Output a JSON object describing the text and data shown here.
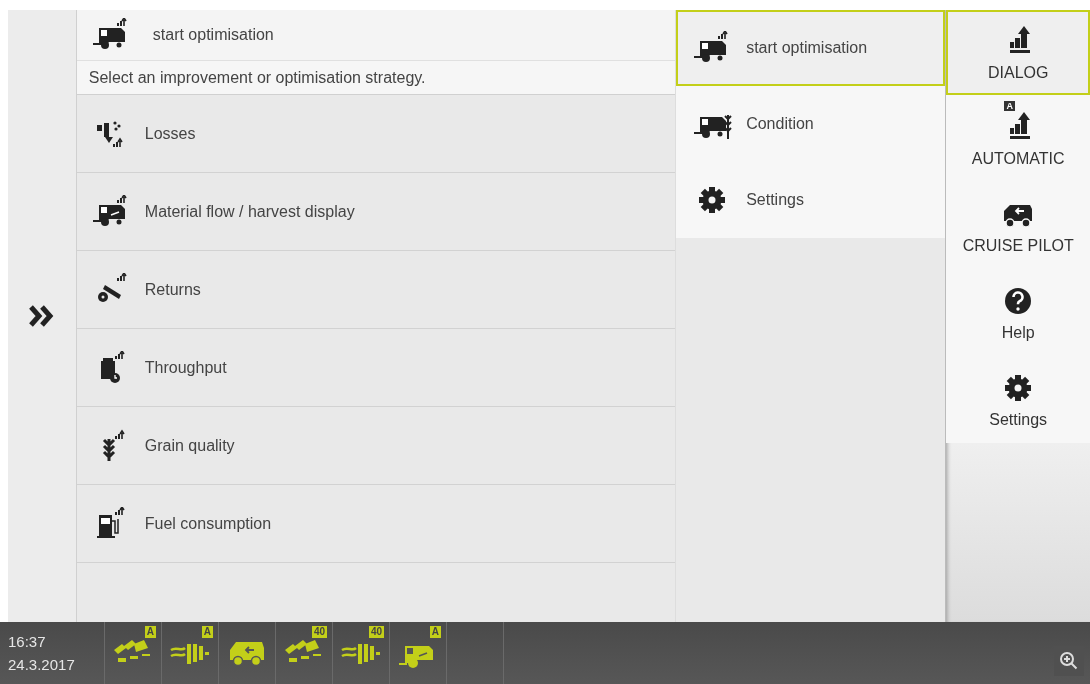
{
  "strategy": {
    "title": "start optimisation",
    "prompt": "Select an improvement or optimisation strategy.",
    "options": [
      {
        "kind": "losses",
        "label": "Losses"
      },
      {
        "kind": "material",
        "label": "Material flow / harvest display"
      },
      {
        "kind": "returns",
        "label": "Returns"
      },
      {
        "kind": "throughput",
        "label": "Throughput"
      },
      {
        "kind": "grain",
        "label": "Grain quality"
      },
      {
        "kind": "fuel",
        "label": "Fuel consumption"
      }
    ]
  },
  "menu": [
    {
      "kind": "combine",
      "label": "start optimisation",
      "selected": true
    },
    {
      "kind": "condition",
      "label": "Condition",
      "selected": false
    },
    {
      "kind": "gear",
      "label": "Settings",
      "selected": false
    }
  ],
  "nav": [
    {
      "kind": "cemos",
      "label": "DIALOG",
      "selected": true
    },
    {
      "kind": "cemos",
      "label": "AUTOMATIC",
      "badge": "A",
      "selected": false
    },
    {
      "kind": "cruise",
      "label": "CRUISE PILOT",
      "selected": false
    },
    {
      "kind": "help",
      "label": "Help",
      "selected": false
    },
    {
      "kind": "gear",
      "label": "Settings",
      "selected": false
    }
  ],
  "status_bar": {
    "time": "16:37",
    "date": "24.3.2017",
    "tiles": [
      {
        "kind": "cutter",
        "badge": "A"
      },
      {
        "kind": "straw",
        "badge": "A"
      },
      {
        "kind": "cruise"
      },
      {
        "kind": "cutter",
        "badge": "40"
      },
      {
        "kind": "straw",
        "badge": "40"
      },
      {
        "kind": "combine",
        "badge": "A"
      }
    ]
  }
}
